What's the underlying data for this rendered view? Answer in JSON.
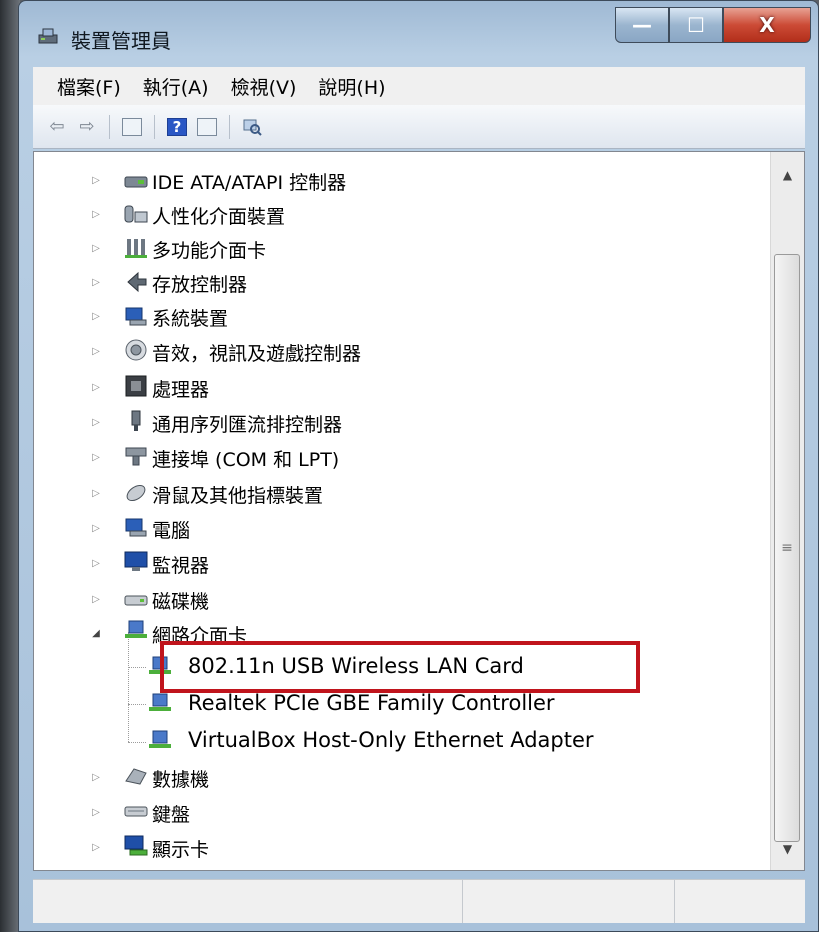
{
  "window": {
    "title": "裝置管理員",
    "buttons": {
      "minimize": "—",
      "maximize": "☐",
      "close": "X"
    }
  },
  "menu": [
    "檔案(F)",
    "執行(A)",
    "檢視(V)",
    "說明(H)"
  ],
  "toolbar": {
    "back": "⇦",
    "forward": "⇨",
    "help_glyph": "?"
  },
  "tree": {
    "items": [
      {
        "label": "IDE ATA/ATAPI 控制器",
        "icon": "ide-controller-icon",
        "expanded": false
      },
      {
        "label": "人性化介面裝置",
        "icon": "hid-icon",
        "expanded": false
      },
      {
        "label": "多功能介面卡",
        "icon": "multifunction-adapter-icon",
        "expanded": false
      },
      {
        "label": "存放控制器",
        "icon": "storage-controller-icon",
        "expanded": false
      },
      {
        "label": "系統裝置",
        "icon": "system-device-icon",
        "expanded": false
      },
      {
        "label": "音效，視訊及遊戲控制器",
        "icon": "sound-icon",
        "expanded": false
      },
      {
        "label": "處理器",
        "icon": "processor-icon",
        "expanded": false
      },
      {
        "label": "通用序列匯流排控制器",
        "icon": "usb-icon",
        "expanded": false
      },
      {
        "label": "連接埠 (COM 和 LPT)",
        "icon": "port-icon",
        "expanded": false
      },
      {
        "label": "滑鼠及其他指標裝置",
        "icon": "mouse-icon",
        "expanded": false
      },
      {
        "label": "電腦",
        "icon": "computer-icon",
        "expanded": false
      },
      {
        "label": "監視器",
        "icon": "monitor-icon",
        "expanded": false
      },
      {
        "label": "磁碟機",
        "icon": "disk-drive-icon",
        "expanded": false
      },
      {
        "label": "網路介面卡",
        "icon": "network-adapter-icon",
        "expanded": true,
        "children": [
          {
            "label": "802.11n USB Wireless LAN Card",
            "highlighted": true
          },
          {
            "label": "Realtek PCIe GBE Family Controller"
          },
          {
            "label": "VirtualBox Host-Only Ethernet Adapter"
          }
        ]
      },
      {
        "label": "數據機",
        "icon": "modem-icon",
        "expanded": false
      },
      {
        "label": "鍵盤",
        "icon": "keyboard-icon",
        "expanded": false
      },
      {
        "label": "顯示卡",
        "icon": "display-adapter-icon",
        "expanded": false
      }
    ]
  },
  "scrollbar": {
    "up": "▲",
    "down": "▼",
    "grip": "≡"
  },
  "colors": {
    "highlight_border": "#c0141c",
    "title_gradient_top": "#9fb9d4",
    "close_button": "#cc4b36"
  }
}
